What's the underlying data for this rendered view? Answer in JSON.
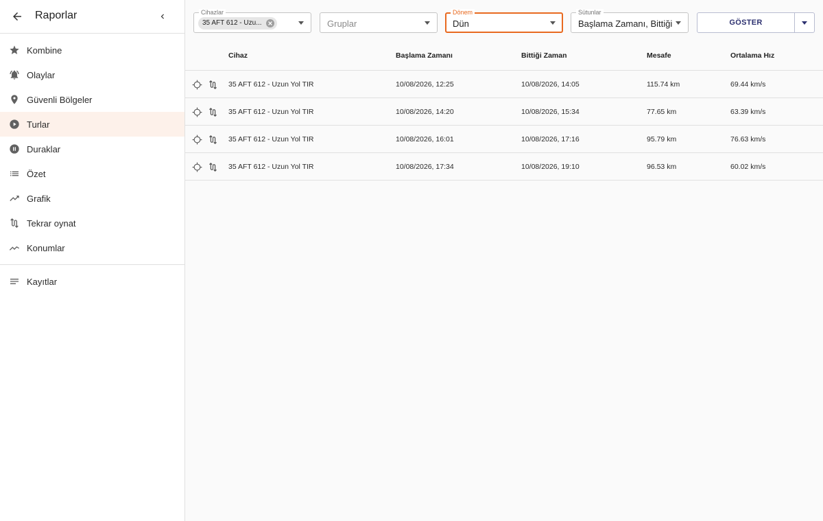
{
  "sidebar": {
    "title": "Raporlar",
    "items": [
      {
        "label": "Kombine",
        "icon": "star-icon"
      },
      {
        "label": "Olaylar",
        "icon": "bell-icon"
      },
      {
        "label": "Güvenli Bölgeler",
        "icon": "pin-icon"
      },
      {
        "label": "Turlar",
        "icon": "play-circle-icon"
      },
      {
        "label": "Duraklar",
        "icon": "pause-circle-icon"
      },
      {
        "label": "Özet",
        "icon": "list-icon"
      },
      {
        "label": "Grafik",
        "icon": "trending-up-icon"
      },
      {
        "label": "Tekrar oynat",
        "icon": "route-icon"
      },
      {
        "label": "Konumlar",
        "icon": "timeline-icon"
      }
    ],
    "extra_items": [
      {
        "label": "Kayıtlar",
        "icon": "notes-icon"
      }
    ],
    "active_item": "Turlar"
  },
  "filters": {
    "devices": {
      "label": "Cihazlar",
      "chip": "35 AFT 612 - Uzu..."
    },
    "groups": {
      "placeholder": "Gruplar"
    },
    "period": {
      "label": "Dönem",
      "value": "Dün"
    },
    "columns": {
      "label": "Sütunlar",
      "value": "Başlama Zamanı, Bittiği ..."
    },
    "show_label": "GÖSTER"
  },
  "colors": {
    "accent": "#e8691f",
    "active_bg": "#fdf1ea",
    "button_text": "#2d3170"
  },
  "table": {
    "headers": [
      "Cihaz",
      "Başlama Zamanı",
      "Bittiği Zaman",
      "Mesafe",
      "Ortalama Hız"
    ],
    "rows": [
      {
        "device": "35 AFT 612 - Uzun Yol TIR",
        "start": "10/08/2026, 12:25",
        "end": "10/08/2026, 14:05",
        "distance": "115.74 km",
        "avg_speed": "69.44 km/s"
      },
      {
        "device": "35 AFT 612 - Uzun Yol TIR",
        "start": "10/08/2026, 14:20",
        "end": "10/08/2026, 15:34",
        "distance": "77.65 km",
        "avg_speed": "63.39 km/s"
      },
      {
        "device": "35 AFT 612 - Uzun Yol TIR",
        "start": "10/08/2026, 16:01",
        "end": "10/08/2026, 17:16",
        "distance": "95.79 km",
        "avg_speed": "76.63 km/s"
      },
      {
        "device": "35 AFT 612 - Uzun Yol TIR",
        "start": "10/08/2026, 17:34",
        "end": "10/08/2026, 19:10",
        "distance": "96.53 km",
        "avg_speed": "60.02 km/s"
      }
    ]
  }
}
